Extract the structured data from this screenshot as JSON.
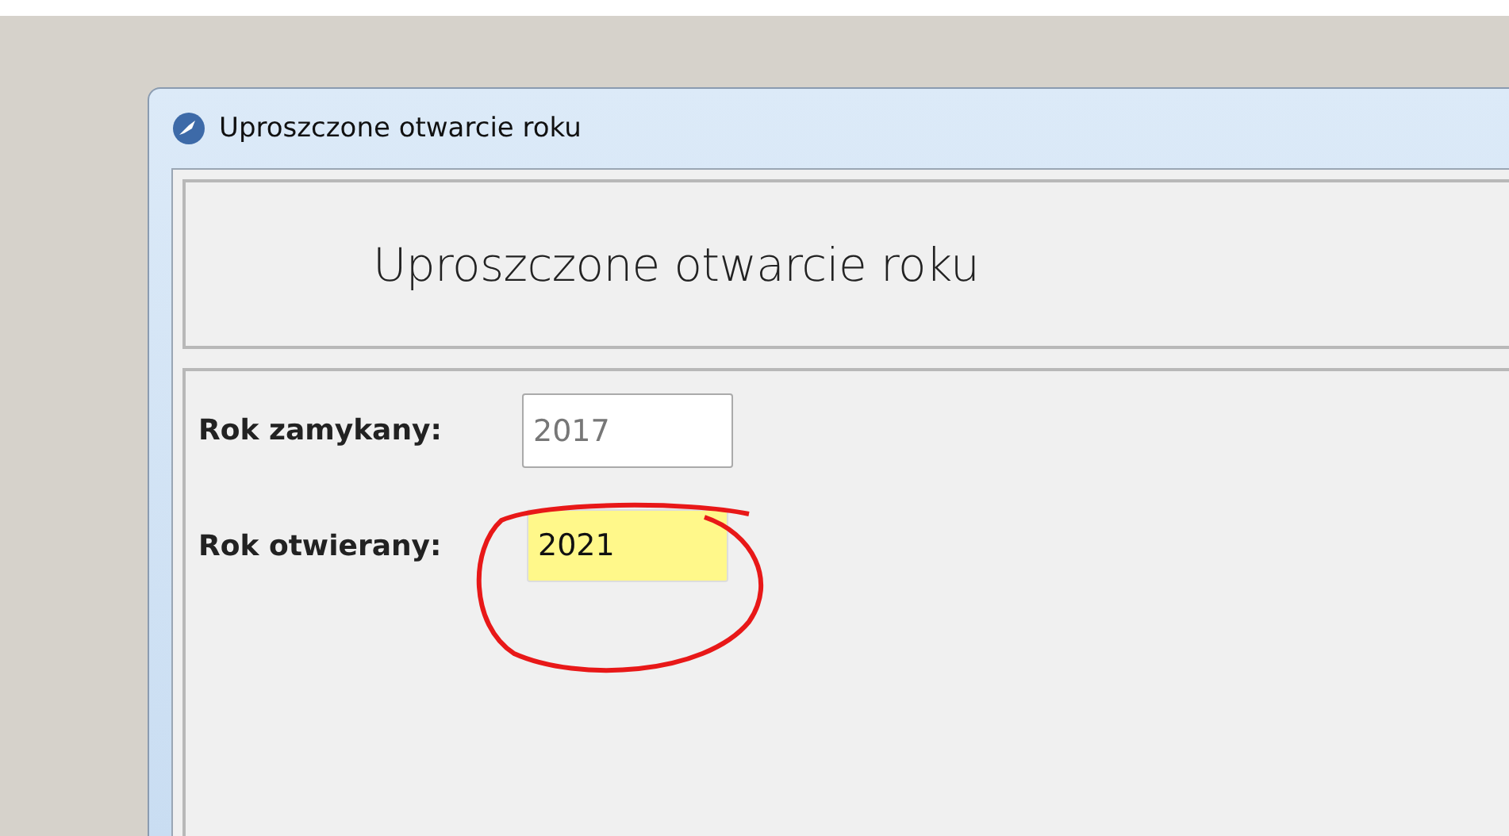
{
  "window": {
    "title": "Uproszczone otwarcie roku"
  },
  "header": {
    "heading": "Uproszczone otwarcie roku"
  },
  "fields": [
    {
      "label": "Rok zamykany:",
      "value": "2017",
      "disabled": true,
      "highlighted": false
    },
    {
      "label": "Rok otwierany:",
      "value": "2021",
      "disabled": false,
      "highlighted": true
    }
  ]
}
